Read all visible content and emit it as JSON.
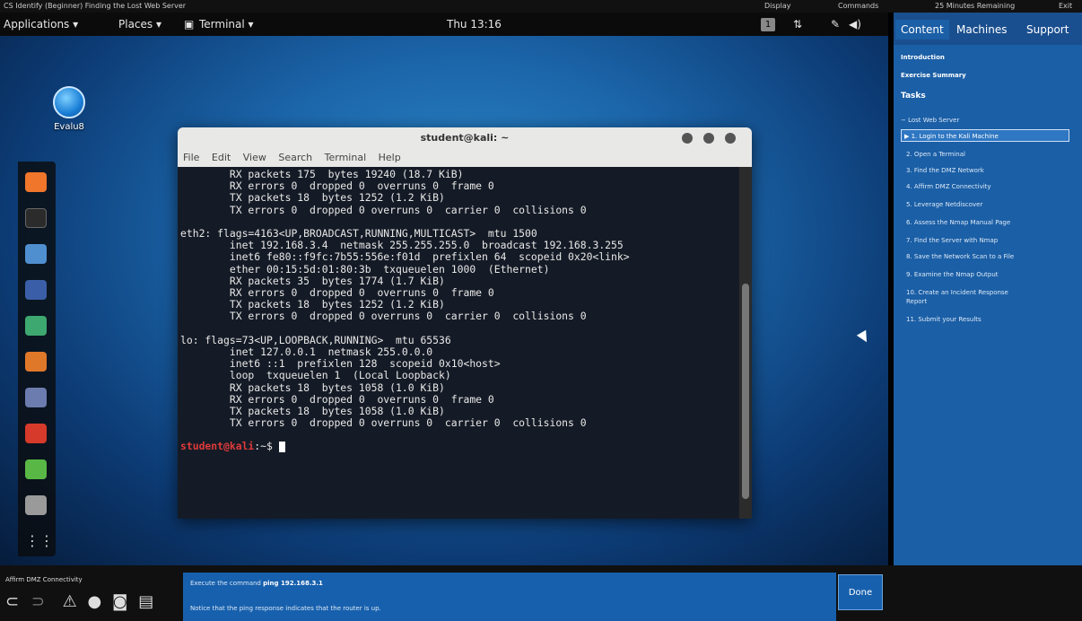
{
  "lab_bar": {
    "title": "CS Identify (Beginner) Finding the Lost Web Server",
    "display": "Display",
    "commands": "Commands",
    "timer": "25 Minutes Remaining",
    "exit": "Exit"
  },
  "gnome": {
    "applications": "Applications ▾",
    "places": "Places ▾",
    "terminal": "Terminal ▾",
    "clock": "Thu 13:16",
    "workspace": "1"
  },
  "desktop": {
    "icon_label": "Evalu8"
  },
  "terminal": {
    "title": "student@kali: ~",
    "menu": [
      "File",
      "Edit",
      "View",
      "Search",
      "Terminal",
      "Help"
    ],
    "lines": [
      "        RX packets 175  bytes 19240 (18.7 KiB)",
      "        RX errors 0  dropped 0  overruns 0  frame 0",
      "        TX packets 18  bytes 1252 (1.2 KiB)",
      "        TX errors 0  dropped 0 overruns 0  carrier 0  collisions 0",
      "",
      "eth2: flags=4163<UP,BROADCAST,RUNNING,MULTICAST>  mtu 1500",
      "        inet 192.168.3.4  netmask 255.255.255.0  broadcast 192.168.3.255",
      "        inet6 fe80::f9fc:7b55:556e:f01d  prefixlen 64  scopeid 0x20<link>",
      "        ether 00:15:5d:01:80:3b  txqueuelen 1000  (Ethernet)",
      "        RX packets 35  bytes 1774 (1.7 KiB)",
      "        RX errors 0  dropped 0  overruns 0  frame 0",
      "        TX packets 18  bytes 1252 (1.2 KiB)",
      "        TX errors 0  dropped 0 overruns 0  carrier 0  collisions 0",
      "",
      "lo: flags=73<UP,LOOPBACK,RUNNING>  mtu 65536",
      "        inet 127.0.0.1  netmask 255.0.0.0",
      "        inet6 ::1  prefixlen 128  scopeid 0x10<host>",
      "        loop  txqueuelen 1  (Local Loopback)",
      "        RX packets 18  bytes 1058 (1.0 KiB)",
      "        RX errors 0  dropped 0  overruns 0  frame 0",
      "        TX packets 18  bytes 1058 (1.0 KiB)",
      "        TX errors 0  dropped 0 overruns 0  carrier 0  collisions 0"
    ],
    "prompt_user": "student@kali",
    "prompt_rest": ":~$ "
  },
  "panel": {
    "tabs": [
      "Content",
      "Machines",
      "Support"
    ],
    "introduction": "Introduction",
    "exercise_summary": "Exercise Summary",
    "tasks_heading": "Tasks",
    "group": "− Lost Web Server",
    "tasks": [
      "▶ 1. Login to the Kali Machine",
      "2. Open a Terminal",
      "3. Find the DMZ Network",
      "4. Affirm DMZ Connectivity",
      "5. Leverage Netdiscover",
      "6. Assess the Nmap Manual Page",
      "7. Find the Server with Nmap",
      "8. Save the Network Scan to a File",
      "9. Examine the Nmap Output",
      "10. Create an Incident Response",
      "Report",
      "11. Submit your Results"
    ]
  },
  "bottom": {
    "step_label": "Affirm DMZ Connectivity",
    "instruction_prefix": "Execute the command",
    "instruction_command": "ping 192.168.3.1",
    "instruction_note": "Notice that the ping response indicates that the router is up.",
    "done_label": "Done"
  }
}
